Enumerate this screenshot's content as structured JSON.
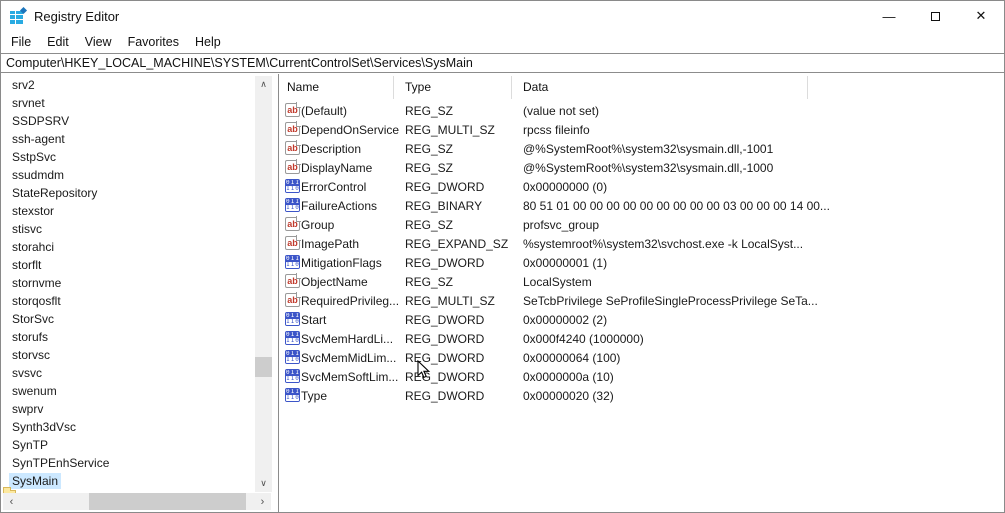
{
  "window": {
    "title": "Registry Editor",
    "controls": {
      "minimize_glyph": "—",
      "close_glyph": "✕"
    }
  },
  "menu": {
    "items": [
      "File",
      "Edit",
      "View",
      "Favorites",
      "Help"
    ]
  },
  "address_bar": {
    "value": "Computer\\HKEY_LOCAL_MACHINE\\SYSTEM\\CurrentControlSet\\Services\\SysMain"
  },
  "tree": {
    "items": [
      {
        "label": "srv2",
        "selected": false
      },
      {
        "label": "srvnet",
        "selected": false
      },
      {
        "label": "SSDPSRV",
        "selected": false
      },
      {
        "label": "ssh-agent",
        "selected": false
      },
      {
        "label": "SstpSvc",
        "selected": false
      },
      {
        "label": "ssudmdm",
        "selected": false
      },
      {
        "label": "StateRepository",
        "selected": false
      },
      {
        "label": "stexstor",
        "selected": false
      },
      {
        "label": "stisvc",
        "selected": false
      },
      {
        "label": "storahci",
        "selected": false
      },
      {
        "label": "storflt",
        "selected": false
      },
      {
        "label": "stornvme",
        "selected": false
      },
      {
        "label": "storqosflt",
        "selected": false
      },
      {
        "label": "StorSvc",
        "selected": false
      },
      {
        "label": "storufs",
        "selected": false
      },
      {
        "label": "storvsc",
        "selected": false
      },
      {
        "label": "svsvc",
        "selected": false
      },
      {
        "label": "swenum",
        "selected": false
      },
      {
        "label": "swprv",
        "selected": false
      },
      {
        "label": "Synth3dVsc",
        "selected": false
      },
      {
        "label": "SynTP",
        "selected": false
      },
      {
        "label": "SynTPEnhService",
        "selected": false
      },
      {
        "label": "SysMain",
        "selected": true
      }
    ]
  },
  "table": {
    "columns": [
      "Name",
      "Type",
      "Data"
    ],
    "rows": [
      {
        "icon": "string",
        "name": "(Default)",
        "type": "REG_SZ",
        "data": "(value not set)"
      },
      {
        "icon": "string",
        "name": "DependOnService",
        "type": "REG_MULTI_SZ",
        "data": "rpcss fileinfo"
      },
      {
        "icon": "string",
        "name": "Description",
        "type": "REG_SZ",
        "data": "@%SystemRoot%\\system32\\sysmain.dll,-1001"
      },
      {
        "icon": "string",
        "name": "DisplayName",
        "type": "REG_SZ",
        "data": "@%SystemRoot%\\system32\\sysmain.dll,-1000"
      },
      {
        "icon": "dword",
        "name": "ErrorControl",
        "type": "REG_DWORD",
        "data": "0x00000000 (0)"
      },
      {
        "icon": "dword",
        "name": "FailureActions",
        "type": "REG_BINARY",
        "data": "80 51 01 00 00 00 00 00 00 00 00 00 03 00 00 00 14 00..."
      },
      {
        "icon": "string",
        "name": "Group",
        "type": "REG_SZ",
        "data": "profsvc_group"
      },
      {
        "icon": "string",
        "name": "ImagePath",
        "type": "REG_EXPAND_SZ",
        "data": "%systemroot%\\system32\\svchost.exe -k LocalSyst..."
      },
      {
        "icon": "dword",
        "name": "MitigationFlags",
        "type": "REG_DWORD",
        "data": "0x00000001 (1)"
      },
      {
        "icon": "string",
        "name": "ObjectName",
        "type": "REG_SZ",
        "data": "LocalSystem"
      },
      {
        "icon": "string",
        "name": "RequiredPrivileg...",
        "type": "REG_MULTI_SZ",
        "data": "SeTcbPrivilege SeProfileSingleProcessPrivilege SeTa..."
      },
      {
        "icon": "dword",
        "name": "Start",
        "type": "REG_DWORD",
        "data": "0x00000002 (2)"
      },
      {
        "icon": "dword",
        "name": "SvcMemHardLi...",
        "type": "REG_DWORD",
        "data": "0x000f4240 (1000000)"
      },
      {
        "icon": "dword",
        "name": "SvcMemMidLim...",
        "type": "REG_DWORD",
        "data": "0x00000064 (100)"
      },
      {
        "icon": "dword",
        "name": "SvcMemSoftLim...",
        "type": "REG_DWORD",
        "data": "0x0000000a (10)"
      },
      {
        "icon": "dword",
        "name": "Type",
        "type": "REG_DWORD",
        "data": "0x00000020 (32)"
      }
    ]
  },
  "icons": {
    "string_glyph": "ab",
    "dword_top": "011",
    "dword_bottom": "110",
    "scroll_up": "∧",
    "scroll_down": "∨",
    "scroll_left": "‹",
    "scroll_right": "›"
  },
  "colors": {
    "selection": "#cce8ff",
    "string_icon_red": "#c0392b",
    "dword_icon_blue": "#3c55c8",
    "folder_yellow": "#fce9a0",
    "scroll_thumb": "#cdcdcd",
    "scroll_track": "#f0f0f0"
  }
}
